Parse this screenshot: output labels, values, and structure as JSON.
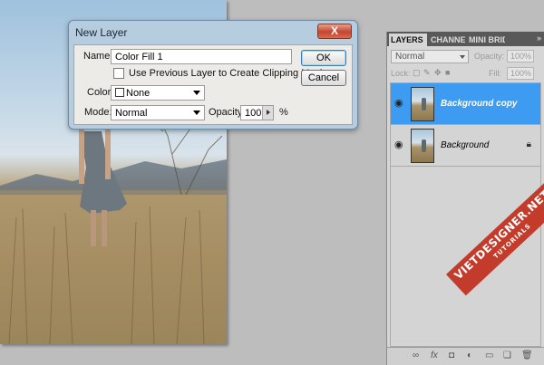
{
  "dialog": {
    "title": "New Layer",
    "close_label": "X",
    "name_label": "Name:",
    "name_value": "Color Fill 1",
    "clipping_label": "Use Previous Layer to Create Clipping Mask",
    "color_label": "Color:",
    "color_value": "None",
    "mode_label": "Mode:",
    "mode_value": "Normal",
    "opacity_label": "Opacity:",
    "opacity_value": "100",
    "opacity_unit": "%",
    "ok_label": "OK",
    "cancel_label": "Cancel"
  },
  "panel": {
    "tabs": [
      "LAYERS",
      "CHANNELS",
      "MINI BRIDGE"
    ],
    "menu_icon": "»",
    "blend_mode": "Normal",
    "opacity_label": "Opacity:",
    "opacity_value": "100%",
    "lock_label": "Lock:",
    "fill_label": "Fill:",
    "fill_value": "100%",
    "layers": [
      {
        "name": "Background copy",
        "selected": true,
        "locked": false
      },
      {
        "name": "Background",
        "selected": false,
        "locked": true
      }
    ]
  },
  "watermark": {
    "main": "VIETDESIGNER.NET",
    "sub": "TUTORIALS"
  },
  "colors": {
    "selected_layer": "#3d9bf1",
    "dialog_frame": "#b6cde0",
    "watermark": "#c33b2b"
  }
}
